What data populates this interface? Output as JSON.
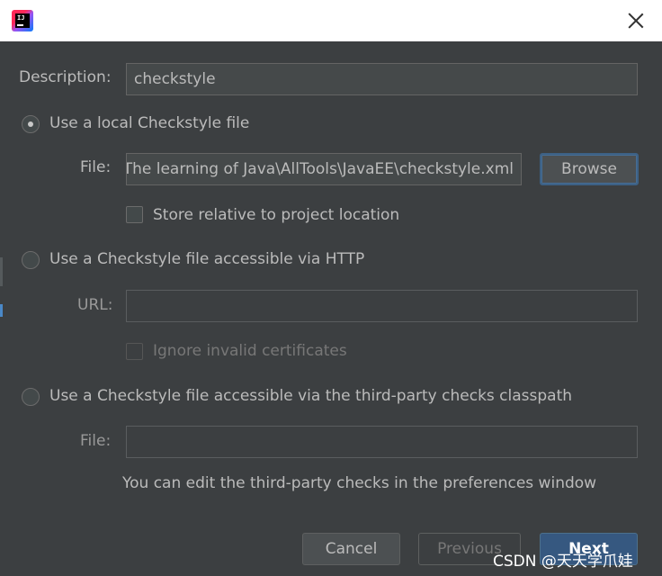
{
  "titlebar": {
    "app_icon": "intellij-idea-icon",
    "close_icon": "close-icon"
  },
  "description": {
    "label": "Description:",
    "value": "checkstyle"
  },
  "options": {
    "local": {
      "label": "Use a local Checkstyle file",
      "selected": true,
      "file_label": "File:",
      "file_value": "D:\\The learning of Java\\AllTools\\JavaEE\\checkstyle.xml",
      "browse_label": "Browse",
      "store_relative_label": "Store relative to project location",
      "store_relative_checked": false
    },
    "http": {
      "label": "Use a Checkstyle file accessible via HTTP",
      "selected": false,
      "url_label": "URL:",
      "url_value": "",
      "ignore_certs_label": "Ignore invalid certificates",
      "ignore_certs_checked": false
    },
    "classpath": {
      "label": "Use a Checkstyle file accessible via the third-party checks classpath",
      "selected": false,
      "file_label": "File:",
      "file_value": "",
      "hint": "You can edit the third-party checks in the preferences window"
    }
  },
  "buttons": {
    "cancel": "Cancel",
    "previous": "Previous",
    "next": "Next"
  },
  "watermark": "CSDN @天天学爪娃"
}
